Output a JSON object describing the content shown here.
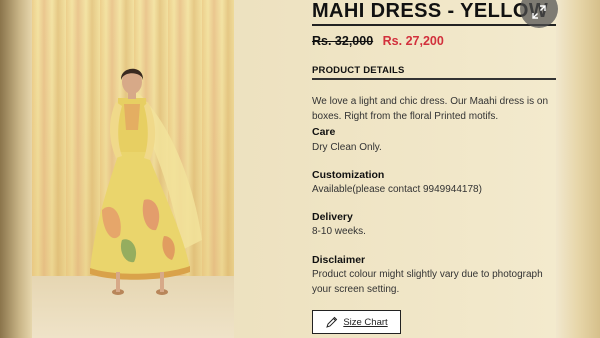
{
  "product": {
    "title": "MAHI DRESS - YELLOW",
    "old_price": "Rs. 32,000",
    "new_price": "Rs. 27,200"
  },
  "details": {
    "heading": "PRODUCT DETAILS",
    "description": "We love a light and chic dress. Our Maahi dress is on boxes. Right from the floral Printed motifs.",
    "care_label": "Care",
    "care_value": "Dry Clean Only.",
    "customization_label": "Customization",
    "customization_value": "Available(please contact 9949944178)",
    "delivery_label": "Delivery",
    "delivery_value": "8-10 weeks.",
    "disclaimer_label": "Disclaimer",
    "disclaimer_value": "Product colour might slightly vary due to photograph your screen setting."
  },
  "actions": {
    "size_chart_label": "Size Chart"
  },
  "icons": {
    "expand": "expand-icon",
    "size_chart": "ruler-pencil-icon"
  },
  "colors": {
    "sale_price": "#d2303c",
    "text": "#111111",
    "dress": "#e9d46a"
  }
}
